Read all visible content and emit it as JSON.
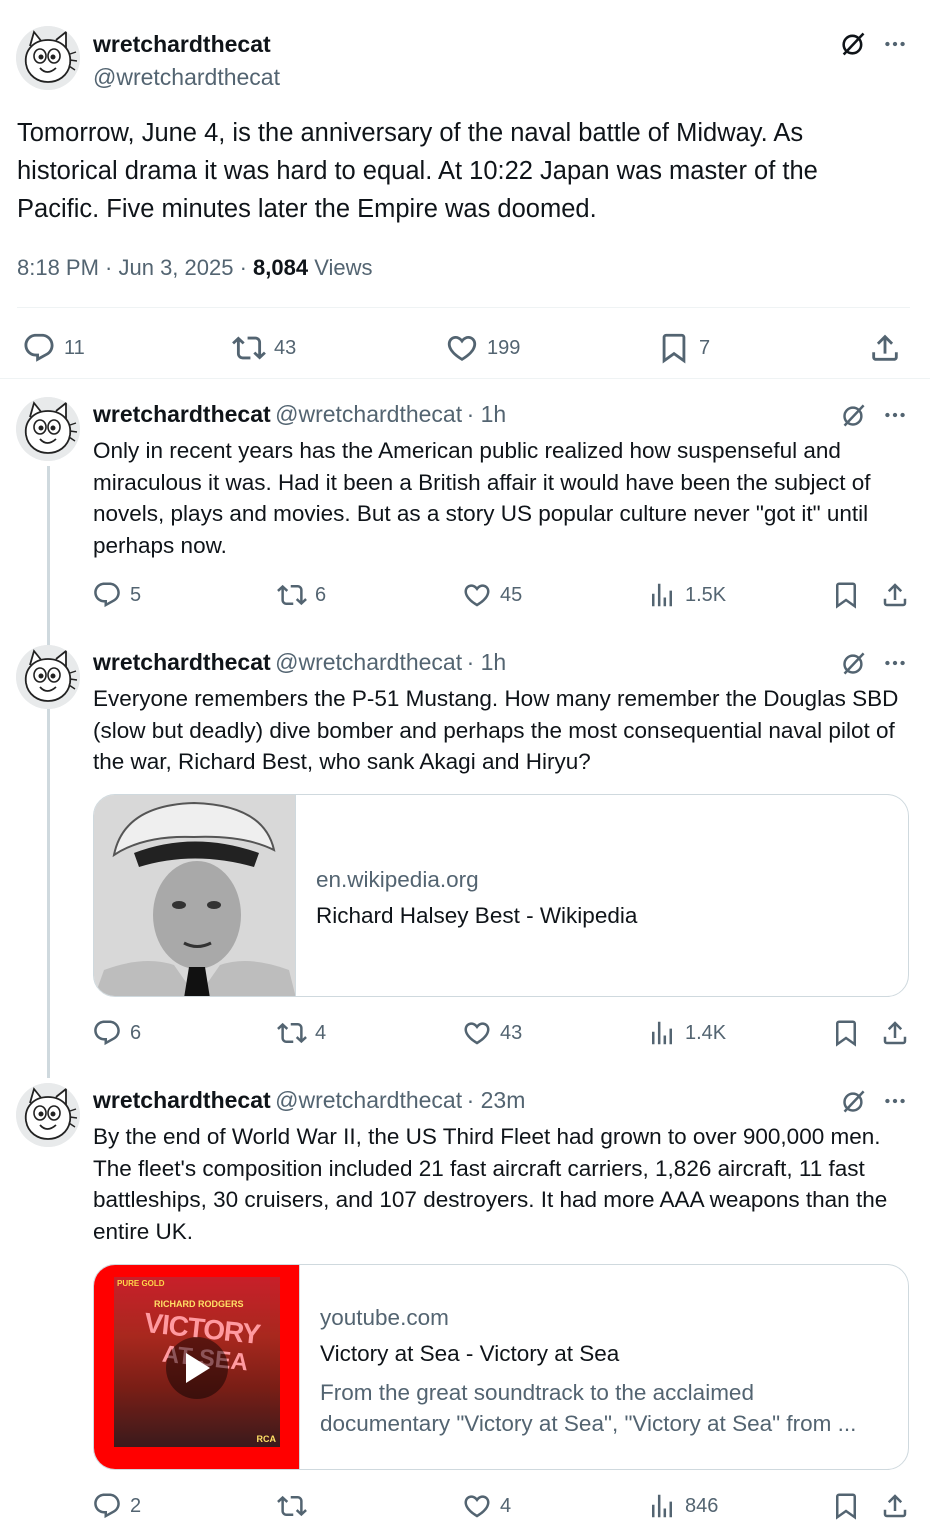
{
  "main_tweet": {
    "display_name": "wretchardthecat",
    "handle": "@wretchardthecat",
    "text": "Tomorrow, June 4, is the anniversary of the naval battle of Midway. As historical drama it was hard to equal. At 10:22 Japan was master of the Pacific. Five minutes later the Empire was doomed.",
    "time": "8:18 PM · Jun 3, 2025 · ",
    "views_count": "8,084",
    "views_label": " Views",
    "replies": "11",
    "reposts": "43",
    "likes": "199",
    "bookmarks": "7"
  },
  "replies": [
    {
      "display_name": "wretchardthecat",
      "handle": "@wretchardthecat",
      "age": "· 1h",
      "text": "Only in recent years has the American public realized how suspenseful and miraculous it was. Had it been a British affair it would have been the subject of novels, plays and movies. But as a story US popular culture never \"got it\" until perhaps now.",
      "replies": "5",
      "reposts": "6",
      "likes": "45",
      "views": "1.5K"
    },
    {
      "display_name": "wretchardthecat",
      "handle": "@wretchardthecat",
      "age": "· 1h",
      "text": "Everyone remembers the P-51 Mustang. How many remember the Douglas SBD (slow but deadly) dive bomber and perhaps the most consequential naval pilot of the war, Richard Best, who sank Akagi and Hiryu?",
      "card": {
        "domain": "en.wikipedia.org",
        "title": "Richard Halsey Best - Wikipedia"
      },
      "replies": "6",
      "reposts": "4",
      "likes": "43",
      "views": "1.4K"
    },
    {
      "display_name": "wretchardthecat",
      "handle": "@wretchardthecat",
      "age": "· 23m",
      "text": "By the end of World War II, the US Third Fleet had grown to over 900,000 men. The fleet's composition included 21 fast aircraft carriers, 1,826 aircraft, 11 fast battleships, 30 cruisers, and 107 destroyers. It had more AAA weapons than the entire UK.",
      "card": {
        "domain": "youtube.com",
        "title": "Victory at Sea - Victory at Sea",
        "description": "From the great soundtrack to the acclaimed documentary \"Victory at Sea\", \"Victory at Sea\" from ...",
        "thumb_label_top": "PURE GOLD",
        "thumb_label_composer": "RICHARD RODGERS",
        "thumb_label_title_1": "VICTORY",
        "thumb_label_title_2": "AT SEA",
        "thumb_label_brand": "RCA"
      },
      "replies": "2",
      "reposts": "",
      "likes": "4",
      "views": "846"
    }
  ],
  "colors": {
    "text": "#0f1419",
    "secondary": "#536471",
    "border": "#cfd9de",
    "youtube_red": "#ff0000"
  },
  "icons": [
    "grok-icon",
    "more-icon",
    "reply-icon",
    "repost-icon",
    "like-icon",
    "bookmark-icon",
    "share-icon",
    "views-icon",
    "play-icon"
  ]
}
